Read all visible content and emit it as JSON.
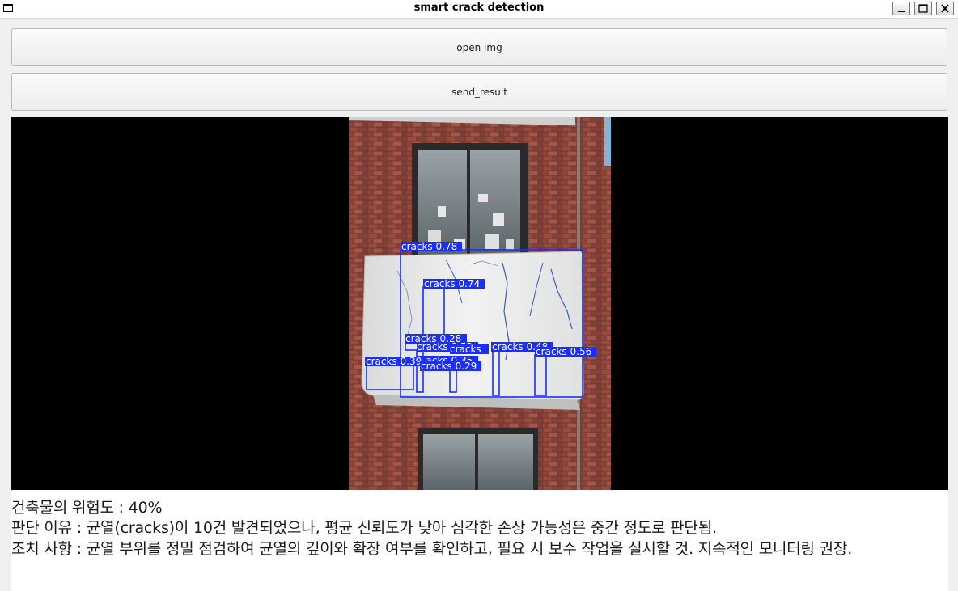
{
  "window": {
    "title": "smart crack detection",
    "controls": [
      "minimize-icon",
      "maximize-icon",
      "close-icon"
    ]
  },
  "toolbar": {
    "open_label": "open img",
    "send_label": "send_result"
  },
  "image_view": {
    "detections": [
      {
        "label": "cracks 0.78"
      },
      {
        "label": "cracks 0.74"
      },
      {
        "label": "cracks 0.28"
      },
      {
        "label": "cracks 0.52"
      },
      {
        "label": "cracks 0.35"
      },
      {
        "label": "cracks 0.39"
      },
      {
        "label": "cracks 0.29"
      },
      {
        "label": "cracks"
      },
      {
        "label": "cracks 0.48"
      },
      {
        "label": "cracks 0.56"
      }
    ],
    "box_color": "#1a2eff"
  },
  "result": {
    "risk_line": "건축물의 위험도 : 40%",
    "reason_line": "판단 이유 : 균열(cracks)이 10건 발견되었으나, 평균 신뢰도가 낮아 심각한 손상 가능성은 중간 정도로 판단됨.",
    "action_line": "조치 사항 : 균열 부위를 정밀 점검하여 균열의 깊이와 확장 여부를 확인하고, 필요 시 보수 작업을 실시할 것. 지속적인 모니터링 권장."
  }
}
